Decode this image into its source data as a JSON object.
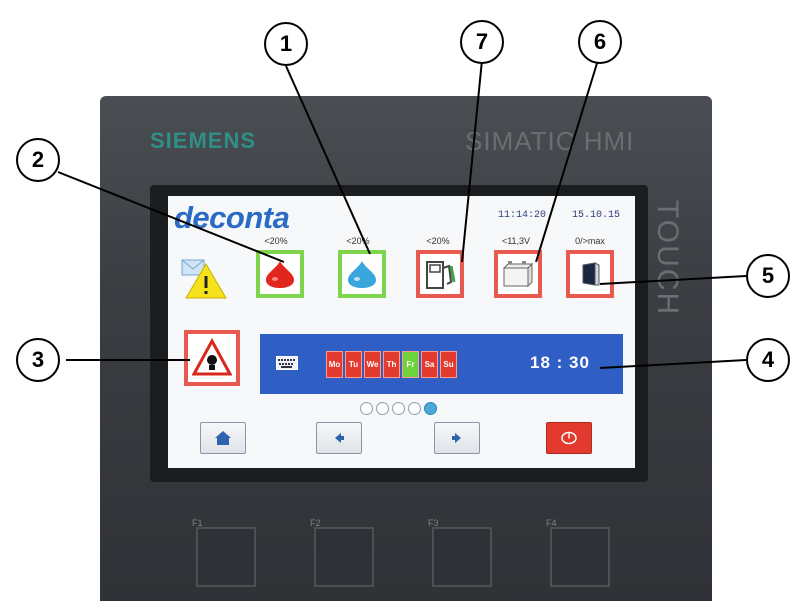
{
  "device": {
    "brand": "SIEMENS",
    "model": "SIMATIC HMI",
    "side_text": "TOUCH",
    "function_keys": [
      "F1",
      "F2",
      "F3",
      "F4"
    ]
  },
  "screen": {
    "logo": "deconta",
    "clock_time": "11:14:20",
    "clock_date": "15.10.15",
    "tiles": [
      {
        "label": "<20%",
        "icon": "red-drop-icon",
        "status": "green"
      },
      {
        "label": "<20%",
        "icon": "blue-drop-icon",
        "status": "green"
      },
      {
        "label": "<20%",
        "icon": "fuel-pump-icon",
        "status": "red"
      },
      {
        "label": "<11,3V",
        "icon": "battery-icon",
        "status": "red"
      },
      {
        "label": "0/>max",
        "icon": "filter-icon",
        "status": "red"
      }
    ],
    "schedule": {
      "days": [
        "Mo",
        "Tu",
        "We",
        "Th",
        "Fr",
        "Sa",
        "Su"
      ],
      "active_day": "Fr",
      "time": "18 : 30"
    },
    "page_indicator": {
      "count": 5,
      "active": 5
    },
    "nav_buttons": [
      "home-icon",
      "arrow-left-icon",
      "arrow-right-icon",
      "power-icon"
    ]
  },
  "callouts": [
    "1",
    "2",
    "3",
    "4",
    "5",
    "6",
    "7"
  ],
  "colors": {
    "tile_ok": "#7ed54c",
    "tile_alarm": "#e85a4f",
    "schedule_bar": "#2f5fc4",
    "day_button": "#e23a2e",
    "day_active": "#6cd43a",
    "logo": "#2a6bc6",
    "brand": "#2f8f86"
  }
}
